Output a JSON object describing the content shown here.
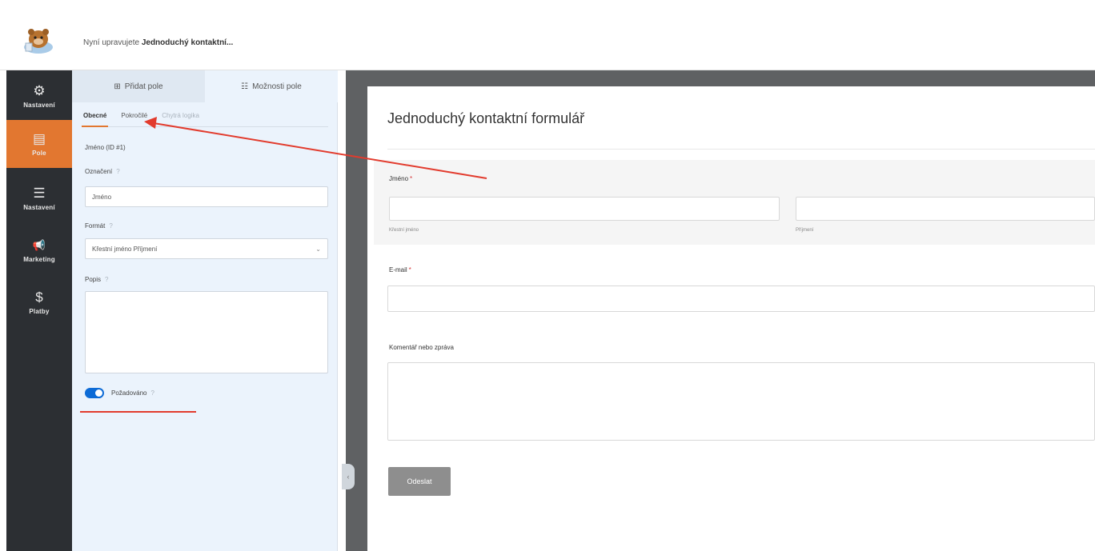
{
  "topbar": {
    "title_prefix": "Nyní upravujete",
    "title_form": "Jednoduchý kontaktní..."
  },
  "leftnav": {
    "items": [
      {
        "label": "Nastavení",
        "icon": "gear-icon",
        "glyph": "⚙"
      },
      {
        "label": "Pole",
        "icon": "fields-icon",
        "glyph": "▤"
      },
      {
        "label": "Nastavení",
        "icon": "sliders-icon",
        "glyph": "☰"
      },
      {
        "label": "Marketing",
        "icon": "megaphone-icon",
        "glyph": "📢"
      },
      {
        "label": "Platby",
        "icon": "dollar-icon",
        "glyph": "$"
      }
    ]
  },
  "panel": {
    "tabs": [
      {
        "label": "Přidat pole",
        "glyph": "⊞"
      },
      {
        "label": "Možnosti pole",
        "glyph": "☷"
      }
    ],
    "subtabs": [
      "Obecné",
      "Pokročilé",
      "Chytrá logika"
    ],
    "field_type": "Jméno (ID #1)",
    "label_label": "Označení",
    "label_value": "Jméno",
    "format_label": "Formát",
    "format_value": "Křestní jméno Příjmení",
    "desc_label": "Popis",
    "required_label": "Požadováno",
    "help_glyph": "?"
  },
  "preview": {
    "title": "Jednoduchý kontaktní formulář",
    "name_label": "Jméno",
    "first_sublabel": "Křestní jméno",
    "last_sublabel": "Příjmení",
    "email_label": "E-mail",
    "comment_label": "Komentář nebo zpráva",
    "submit_label": "Odeslat",
    "required_mark": "*"
  },
  "colors": {
    "accent": "#e27730",
    "nav_bg": "#2c2f33",
    "toggle": "#0d6bd6",
    "annotation": "#e23b2d"
  }
}
